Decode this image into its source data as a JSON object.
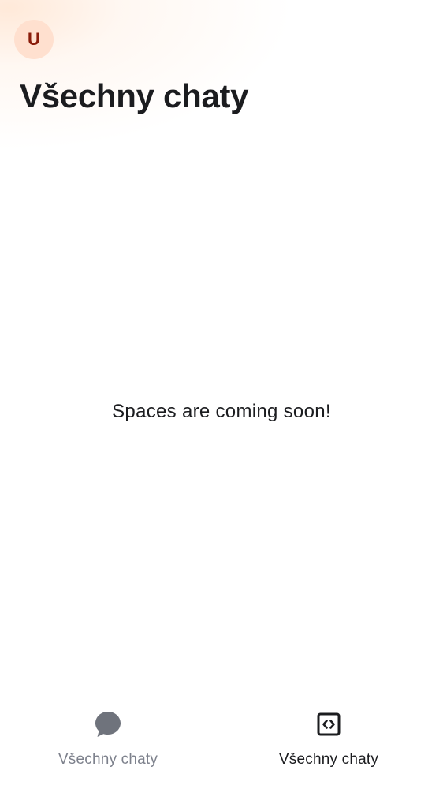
{
  "header": {
    "avatar_letter": "U",
    "title": "Všechny chaty"
  },
  "main": {
    "empty_message": "Spaces are coming soon!"
  },
  "bottom_nav": {
    "items": [
      {
        "label": "Všechny chaty",
        "icon": "chat-bubble-icon",
        "active": false
      },
      {
        "label": "Všechny chaty",
        "icon": "code-brackets-icon",
        "active": true
      }
    ]
  },
  "colors": {
    "avatar_bg": "#ffe0cf",
    "avatar_text": "#8a1c0a",
    "text_primary": "#1b1c1f",
    "text_inactive": "#7d818c",
    "icon_inactive": "#6f737c"
  }
}
